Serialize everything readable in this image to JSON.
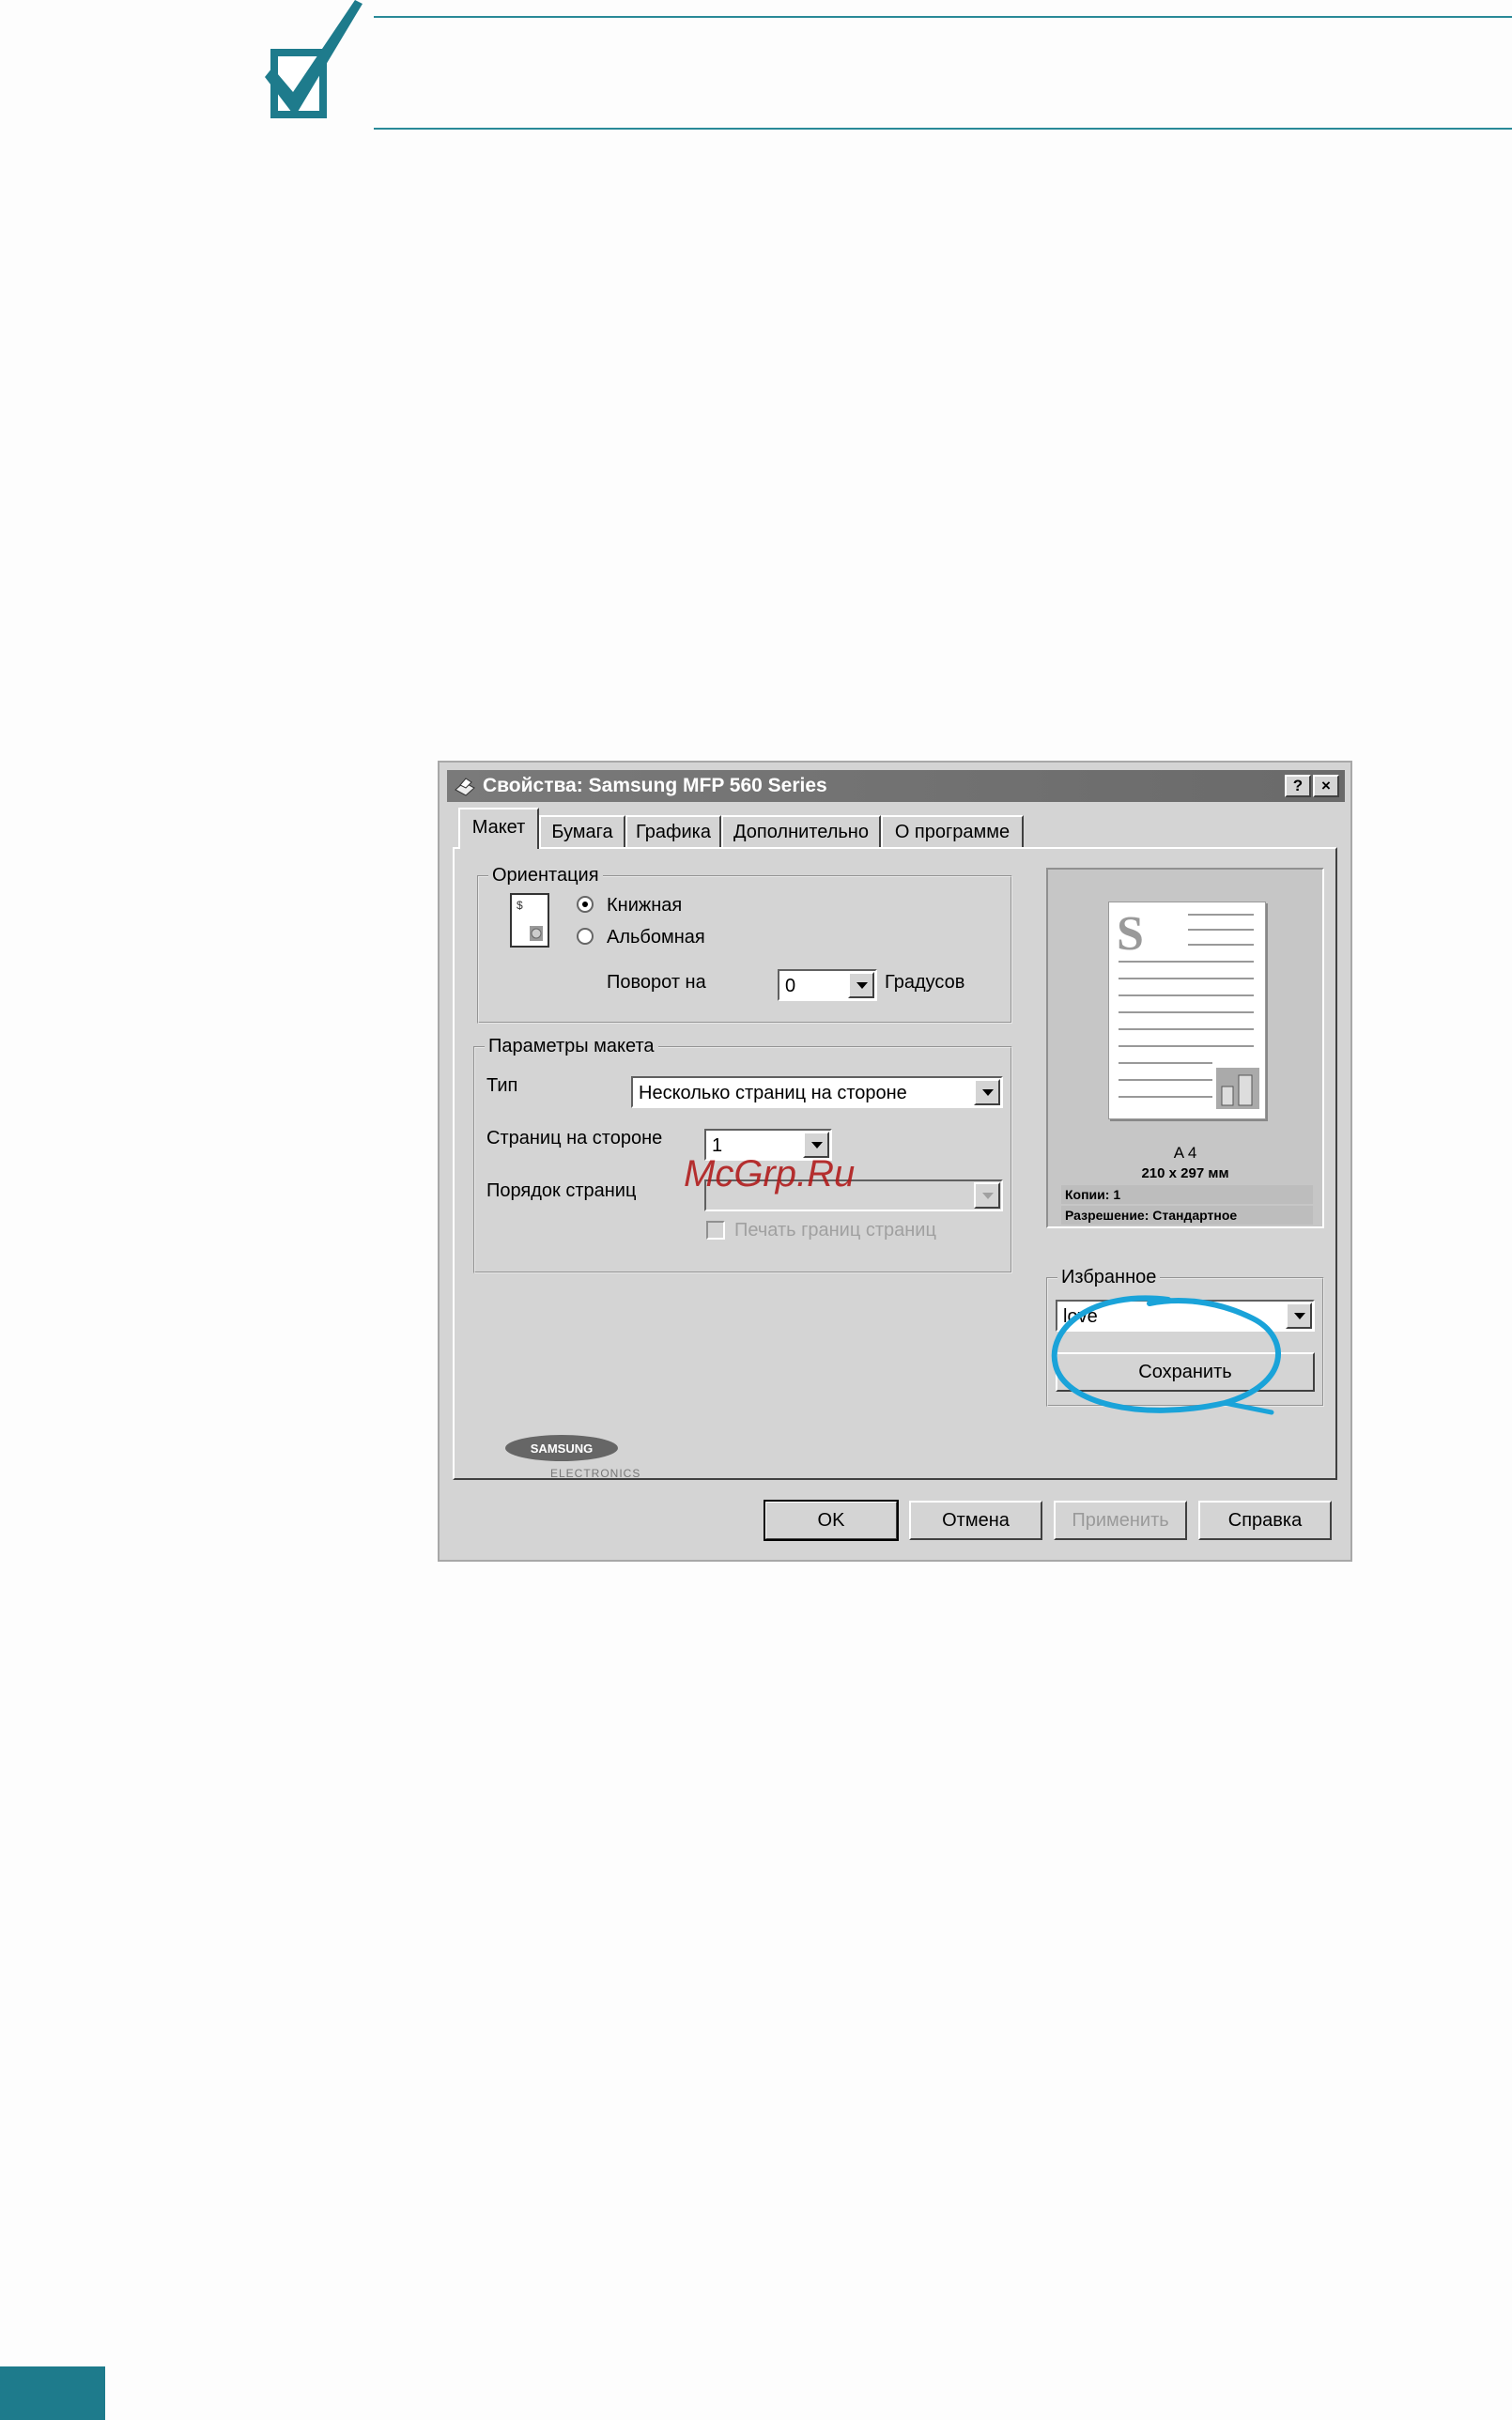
{
  "dialog": {
    "title": "Свойства: Samsung MFP 560 Series",
    "help_btn": "?",
    "close_btn": "×",
    "tabs": [
      "Макет",
      "Бумага",
      "Графика",
      "Дополнительно",
      "О программе"
    ],
    "orientation": {
      "group_title": "Ориентация",
      "portrait": "Книжная",
      "landscape": "Альбомная",
      "rotate_label": "Поворот на",
      "rotate_value": "0",
      "rotate_unit": "Градусов"
    },
    "layout": {
      "group_title": "Параметры макета",
      "type_label": "Тип",
      "type_value": "Несколько страниц на стороне",
      "pages_label": "Страниц на стороне",
      "pages_value": "1",
      "order_label": "Порядок страниц",
      "order_value": "",
      "border_checkbox": "Печать границ страниц"
    },
    "preview": {
      "paper_size": "A 4",
      "dimensions": "210 x 297 мм",
      "copies": "Копии: 1",
      "resolution": "Разрешение: Стандартное"
    },
    "favorites": {
      "group_title": "Избранное",
      "value": "love",
      "save_button": "Сохранить"
    },
    "logo": {
      "brand": "SAMSUNG",
      "sub": "ELECTRONICS"
    },
    "buttons": {
      "ok": "OK",
      "cancel": "Отмена",
      "apply": "Применить",
      "help": "Справка"
    }
  },
  "watermark": "McGrp.Ru",
  "colors": {
    "accent_teal": "#1e7b8c",
    "highlight_circle": "#1aa3d9"
  }
}
